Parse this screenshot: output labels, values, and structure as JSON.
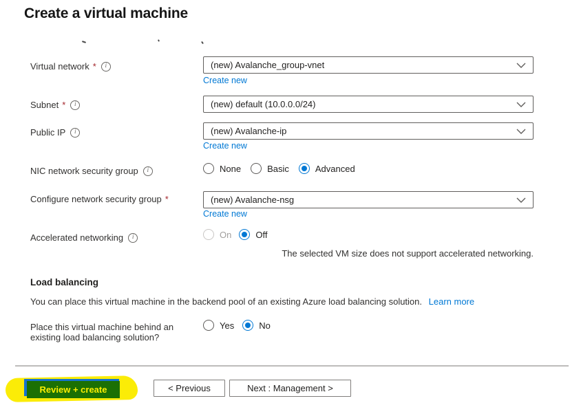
{
  "page": {
    "title": "Create a virtual machine",
    "required_marker": "*"
  },
  "icons": {
    "info": "i"
  },
  "colors": {
    "accent_blue": "#0078d4",
    "link_blue": "#0078d4",
    "required_red": "#a4262c",
    "highlight_yellow": "#fbec07",
    "highlight_green": "#1b7004",
    "review_button_blue": "#1673cf"
  },
  "fields": {
    "virtual_network": {
      "label": "Virtual network",
      "value": "(new) Avalanche_group-vnet",
      "create_new": "Create new"
    },
    "subnet": {
      "label": "Subnet",
      "value": "(new) default (10.0.0.0/24)"
    },
    "public_ip": {
      "label": "Public IP",
      "value": "(new) Avalanche-ip",
      "create_new": "Create new"
    },
    "nic_nsg": {
      "label": "NIC network security group",
      "options": {
        "none": "None",
        "basic": "Basic",
        "advanced": "Advanced"
      },
      "selected": "Advanced"
    },
    "configure_nsg": {
      "label": "Configure network security group",
      "value": "(new) Avalanche-nsg",
      "create_new": "Create new"
    },
    "accelerated_networking": {
      "label": "Accelerated networking",
      "options": {
        "on": "On",
        "off": "Off"
      },
      "selected": "Off",
      "disabled_option": "On",
      "note": "The selected VM size does not support accelerated networking."
    }
  },
  "load_balancing": {
    "heading": "Load balancing",
    "description": "You can place this virtual machine in the backend pool of an existing Azure load balancing solution.",
    "learn_more": "Learn more",
    "question": {
      "label": "Place this virtual machine behind an existing load balancing solution?",
      "options": {
        "yes": "Yes",
        "no": "No"
      },
      "selected": "No"
    }
  },
  "footer": {
    "review_create": "Review + create",
    "previous": "< Previous",
    "next": "Next : Management >"
  }
}
